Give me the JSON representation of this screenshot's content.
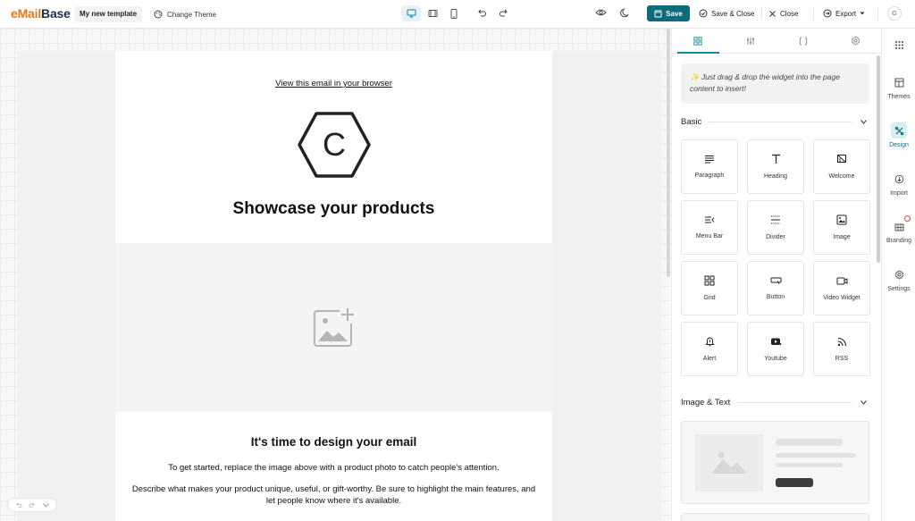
{
  "app": {
    "logo_e": "e",
    "logo_mail": "Mail",
    "logo_base": "Base",
    "template_name": "My new template",
    "change_theme": "Change Theme",
    "save": "Save",
    "save_close": "Save & Close",
    "close": "Close",
    "export": "Export",
    "avatar": "G"
  },
  "email": {
    "view_link": "View this email in your browser",
    "logo_letter": "C",
    "headline": "Showcase your products",
    "section_title": "It's time to design your email",
    "paragraph1": "To get started, replace the image above with a product photo to catch people's attention.",
    "paragraph2": "Describe what makes your product unique, useful, or gift-worthy. Be sure to highlight the main features, and let people know where it's available."
  },
  "panel": {
    "hint": "✨ Just drag & drop the widget into the page content to insert!",
    "sections": [
      {
        "title": "Basic"
      },
      {
        "title": "Image & Text"
      }
    ],
    "widgets": [
      {
        "label": "Paragraph",
        "icon": "paragraph-icon"
      },
      {
        "label": "Heading",
        "icon": "heading-icon"
      },
      {
        "label": "Welcome",
        "icon": "welcome-icon"
      },
      {
        "label": "Menu Bar",
        "icon": "menu-bar-icon"
      },
      {
        "label": "Divider",
        "icon": "divider-icon"
      },
      {
        "label": "Image",
        "icon": "image-icon"
      },
      {
        "label": "Grid",
        "icon": "grid-icon"
      },
      {
        "label": "Button",
        "icon": "button-icon"
      },
      {
        "label": "Video Widget",
        "icon": "video-icon"
      },
      {
        "label": "Alert",
        "icon": "alert-icon"
      },
      {
        "label": "Youtube",
        "icon": "youtube-icon"
      },
      {
        "label": "RSS",
        "icon": "rss-icon"
      }
    ]
  },
  "rail": {
    "items": [
      {
        "label": "Themes"
      },
      {
        "label": "Design"
      },
      {
        "label": "Import"
      },
      {
        "label": "Branding"
      },
      {
        "label": "Settings"
      }
    ]
  },
  "colors": {
    "accent": "#0f6b7a",
    "logo_orange": "#e07a18",
    "logo_dark": "#1d2d44",
    "tab_active": "#0f8aa6"
  }
}
